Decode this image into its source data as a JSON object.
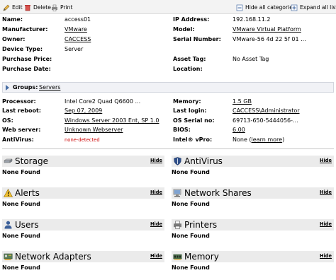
{
  "toolbar": {
    "edit": "Edit",
    "delete": "Delete",
    "print": "Print",
    "hide_all": "Hide all categories",
    "expand_all": "Expand all lists"
  },
  "info_left": [
    {
      "label": "Name:",
      "value": "access01",
      "link": false
    },
    {
      "label": "Manufacturer:",
      "value": "VMware",
      "link": true
    },
    {
      "label": "Owner:",
      "value": "CACCESS",
      "link": true
    },
    {
      "label": "Device Type:",
      "value": "Server",
      "link": false
    },
    {
      "label": "Purchase Price:",
      "value": "",
      "link": false
    },
    {
      "label": "Purchase Date:",
      "value": "",
      "link": false
    }
  ],
  "info_right": [
    {
      "label": "IP Address:",
      "value": "192.168.11.2",
      "link": false
    },
    {
      "label": "Model:",
      "value": "VMware Virtual Platform",
      "link": true
    },
    {
      "label": "Serial Number:",
      "value": "VMware-56 4d 22 5f 01 ...",
      "link": false
    },
    {
      "label": "",
      "value": "",
      "link": false
    },
    {
      "label": "Asset Tag:",
      "value": "No Asset Tag",
      "link": false
    },
    {
      "label": "Location:",
      "value": "",
      "link": false
    }
  ],
  "groups": {
    "label": "Groups:",
    "value": "Servers"
  },
  "detail_left": [
    {
      "label": "Processor:",
      "value": "Intel Core2 Quad Q6600 ..."
    },
    {
      "label": "Last reboot:",
      "value": "Sep 07, 2009"
    },
    {
      "label": "OS:",
      "value": "Windows Server 2003 Ent, SP 1.0"
    },
    {
      "label": "Web server:",
      "value": "Unknown Webserver"
    },
    {
      "label": "AntiVirus:",
      "value": "none-detected"
    }
  ],
  "detail_right": [
    {
      "label": "Memory:",
      "value": "1.5 GB"
    },
    {
      "label": "Last login:",
      "value": "CACCESS\\Administrator"
    },
    {
      "label": "OS Serial no:",
      "value": "69713-650-5444056-..."
    },
    {
      "label": "BIOS:",
      "value": "6.00"
    },
    {
      "label": "Intel® vPro:",
      "value": "None",
      "extra": "learn more"
    }
  ],
  "panels": [
    {
      "title": "Storage",
      "icon": "storage-icon",
      "hide": "Hide",
      "status": "None Found"
    },
    {
      "title": "AntiVirus",
      "icon": "antivirus-shield-icon",
      "hide": "Hide",
      "status": "None Found"
    },
    {
      "title": "Alerts",
      "icon": "alert-warning-icon",
      "hide": "Hide",
      "status": "None Found"
    },
    {
      "title": "Network Shares",
      "icon": "network-shares-icon",
      "hide": "Hide",
      "status": "None Found"
    },
    {
      "title": "Users",
      "icon": "users-icon",
      "hide": "Hide",
      "status": "None Found"
    },
    {
      "title": "Printers",
      "icon": "printer-icon",
      "hide": "Hide",
      "status": "None Found"
    },
    {
      "title": "Network Adapters",
      "icon": "network-adapter-icon",
      "hide": "Hide",
      "status": "None Found"
    },
    {
      "title": "Memory",
      "icon": "memory-icon",
      "hide": "Hide",
      "status": "None Found"
    }
  ]
}
